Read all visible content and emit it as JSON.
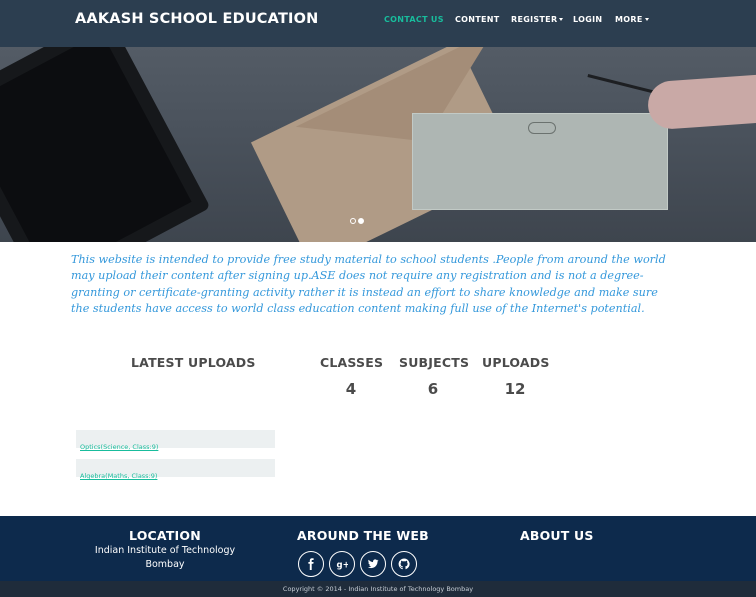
{
  "navbar": {
    "brand": "AAKASH SCHOOL EDUCATION",
    "items": [
      {
        "label": "CONTACT US",
        "active": true
      },
      {
        "label": "CONTENT",
        "active": false
      },
      {
        "label": "REGISTER",
        "dropdown": true
      },
      {
        "label": "LOGIN",
        "active": false
      },
      {
        "label": "MORE",
        "dropdown": true
      }
    ]
  },
  "carousel": {
    "slides": 2,
    "active_index": 1
  },
  "intro": {
    "text": "This website is intended to provide free study material to school students .People from around the world may upload their content after signing up.ASE does not require any registration and is not a degree-granting or certificate-granting activity rather it is instead an effort to share knowledge and make sure the students have access to world class education content making full use of the Internet's potential."
  },
  "stats": {
    "latest_uploads_title": "LATEST UPLOADS",
    "classes_label": "CLASSES",
    "classes_value": "4",
    "subjects_label": "SUBJECTS",
    "subjects_value": "6",
    "uploads_label": "UPLOADS",
    "uploads_value": "12"
  },
  "latest_uploads": [
    {
      "label": "Optics(Science, Class:9)"
    },
    {
      "label": "Algebra(Maths, Class:9)"
    }
  ],
  "footer": {
    "location_title": "LOCATION",
    "location_line1": "Indian Institute of Technology",
    "location_line2": "Bombay",
    "around_title": "AROUND THE WEB",
    "about_title": "ABOUT US",
    "social": [
      {
        "icon": "facebook-icon",
        "glyph": "f"
      },
      {
        "icon": "google-plus-icon",
        "glyph": "g+"
      },
      {
        "icon": "twitter-icon",
        "glyph": "t"
      },
      {
        "icon": "github-icon",
        "glyph": "gh"
      }
    ],
    "copyright": "Copyright © 2014 - Indian Institute of Technology Bombay"
  },
  "colors": {
    "navbar_bg": "#2c3e50",
    "accent": "#18bc9c",
    "intro_text": "#3498db",
    "footer_bg": "#0d2a4c",
    "copyright_bg": "#1f2c3b"
  }
}
